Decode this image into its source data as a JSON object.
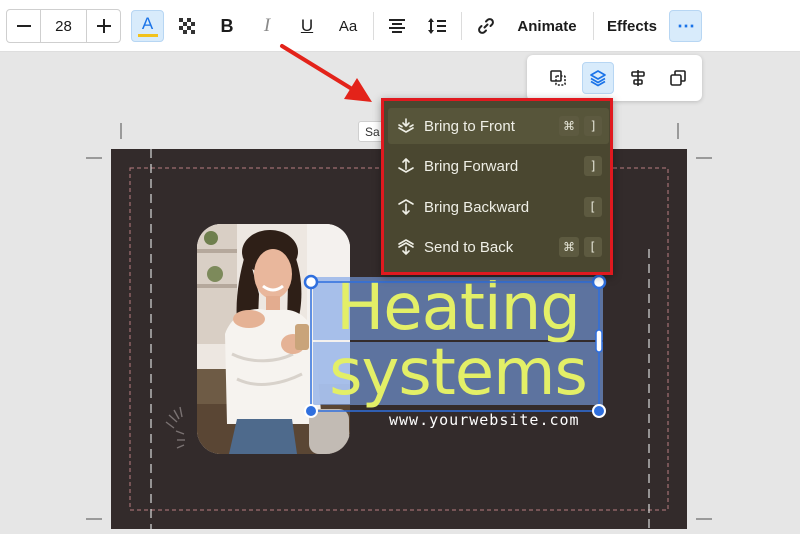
{
  "toolbar": {
    "font_size": "28",
    "animate_label": "Animate",
    "effects_label": "Effects",
    "aa_label": "Aa",
    "bold_label": "B",
    "italic_label": "I",
    "underline_label": "U",
    "text_color_label": "A",
    "more_label": "⋯"
  },
  "canvas": {
    "size_chip": "Sa",
    "headline_line1": "Heating",
    "headline_line2": "systems",
    "website": "www.yourwebsite.com"
  },
  "layer_menu": {
    "items": [
      {
        "label": "Bring to Front",
        "shortcut": [
          "⌘",
          "]"
        ]
      },
      {
        "label": "Bring Forward",
        "shortcut": [
          "]"
        ]
      },
      {
        "label": "Bring Backward",
        "shortcut": [
          "["
        ]
      },
      {
        "label": "Send to Back",
        "shortcut": [
          "⌘",
          "["
        ]
      }
    ]
  },
  "colors": {
    "accent": "#1a73e8",
    "highlight_box": "#e0191f",
    "menu_bg": "#4a4730",
    "headline": "#e3ef67",
    "canvas_bg": "#332b2b"
  }
}
